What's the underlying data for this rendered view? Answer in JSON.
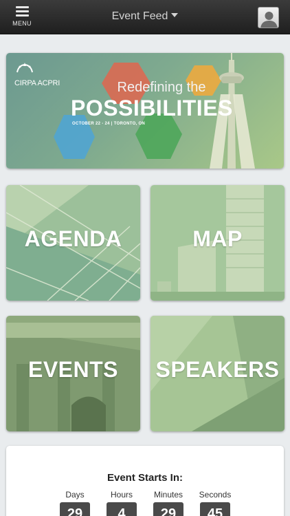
{
  "topbar": {
    "menu_label": "MENU",
    "title": "Event Feed",
    "icons": {
      "menu": "hamburger-icon",
      "dropdown": "caret-down-icon",
      "user": "user-avatar-icon"
    }
  },
  "banner": {
    "brand": "CIRPA ACPRI",
    "tagline": "Redefining the",
    "headline": "POSSIBILITIES",
    "dates": "OCTOBER 22 - 24  |  TORONTO, ON",
    "colors": {
      "red": "#e0664f",
      "blue": "#4ea4d6",
      "green": "#4aa657",
      "orange": "#f2a93b"
    }
  },
  "tiles": [
    {
      "label": "AGENDA"
    },
    {
      "label": "MAP"
    },
    {
      "label": "EVENTS"
    },
    {
      "label": "SPEAKERS"
    }
  ],
  "countdown": {
    "title": "Event Starts In:",
    "units": [
      {
        "label": "Days",
        "value": "29"
      },
      {
        "label": "Hours",
        "value": "4"
      },
      {
        "label": "Minutes",
        "value": "29"
      },
      {
        "label": "Seconds",
        "value": "45"
      }
    ]
  },
  "accent": "#5c9a8b"
}
